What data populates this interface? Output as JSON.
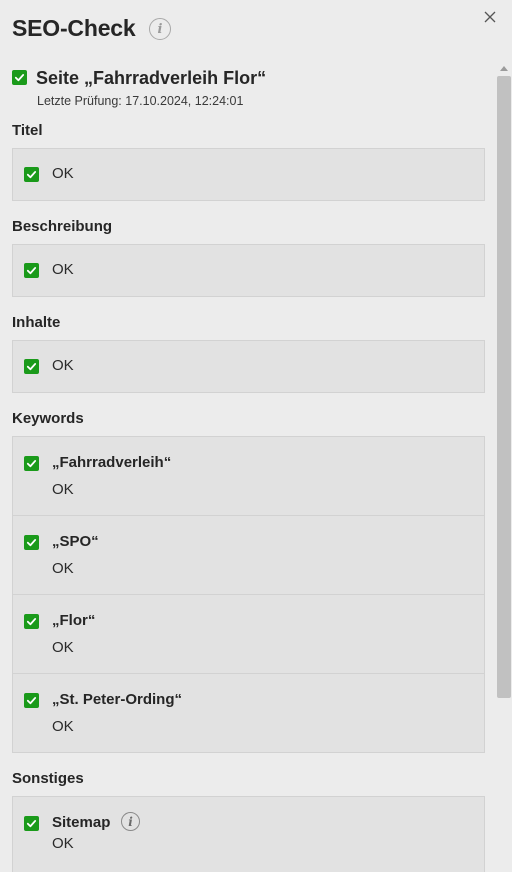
{
  "header": {
    "title": "SEO-Check",
    "info_icon": "info-icon",
    "close_icon": "close-icon"
  },
  "page": {
    "title": "Seite „Fahrradverleih Flor“",
    "last_check": "Letzte Prüfung: 17.10.2024, 12:24:01"
  },
  "sections": {
    "titel": {
      "label": "Titel",
      "status": "OK"
    },
    "beschreibung": {
      "label": "Beschreibung",
      "status": "OK"
    },
    "inhalte": {
      "label": "Inhalte",
      "status": "OK"
    },
    "keywords": {
      "label": "Keywords",
      "items": [
        {
          "name": "„Fahrradverleih“",
          "status": "OK"
        },
        {
          "name": "„SPO“",
          "status": "OK"
        },
        {
          "name": "„Flor“",
          "status": "OK"
        },
        {
          "name": "„St. Peter-Ording“",
          "status": "OK"
        }
      ]
    },
    "sonstiges": {
      "label": "Sonstiges",
      "items": [
        {
          "name": "Sitemap",
          "status": "OK"
        }
      ]
    }
  },
  "colors": {
    "check_green": "#1a9a1a",
    "panel_bg": "#ececec",
    "box_bg": "#e2e2e2"
  }
}
